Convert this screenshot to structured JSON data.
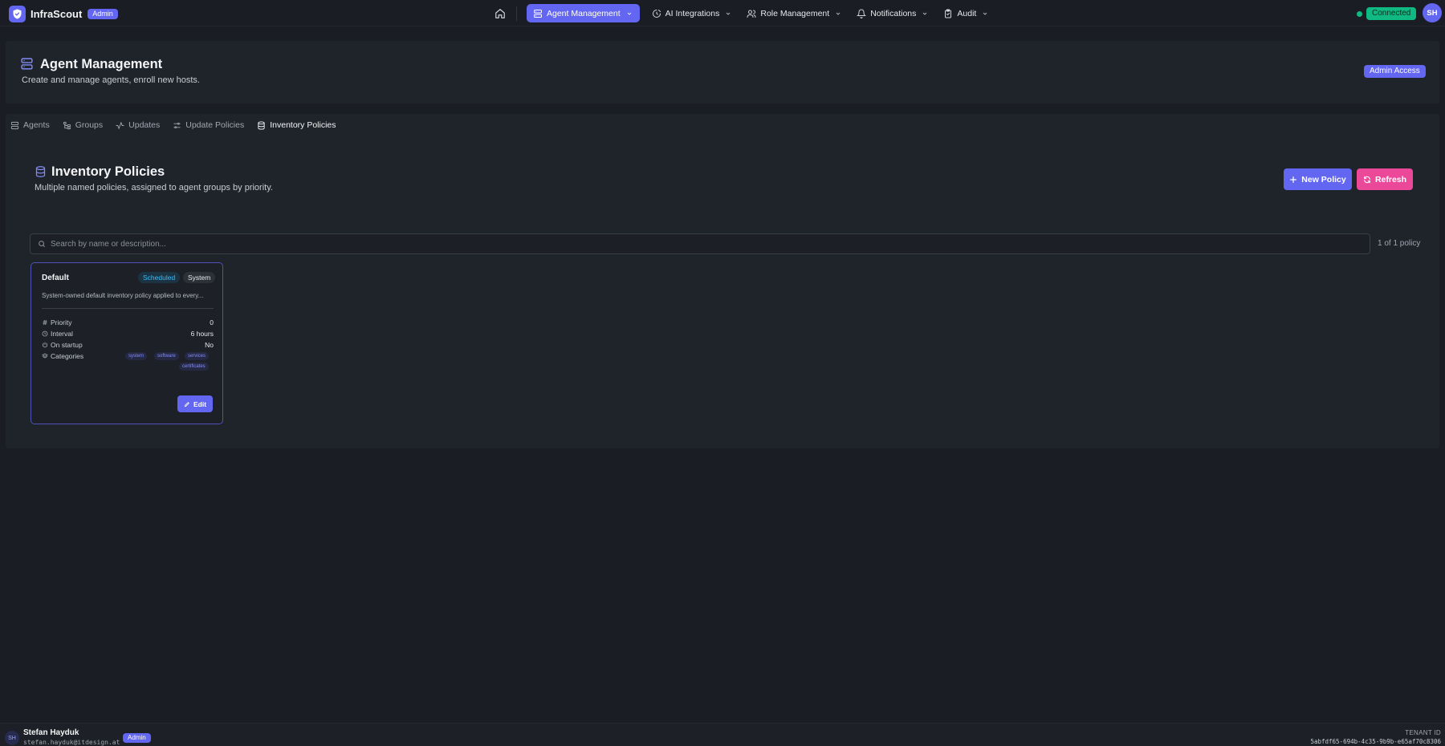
{
  "app": {
    "name": "InfraScout",
    "role_badge": "Admin"
  },
  "nav": {
    "home_icon": "home-icon",
    "items": [
      {
        "label": "Agent Management",
        "icon": "server-icon",
        "active": true
      },
      {
        "label": "AI Integrations",
        "icon": "ai-icon",
        "active": false
      },
      {
        "label": "Role Management",
        "icon": "users-icon",
        "active": false
      },
      {
        "label": "Notifications",
        "icon": "bell-icon",
        "active": false
      },
      {
        "label": "Audit",
        "icon": "clipboard-icon",
        "active": false
      }
    ]
  },
  "status": {
    "label": "Connected",
    "color": "#10b981"
  },
  "user_avatar": "SH",
  "page": {
    "title": "Agent Management",
    "subtitle": "Create and manage agents, enroll new hosts.",
    "access_badge": "Admin Access"
  },
  "tabs": [
    {
      "label": "Agents",
      "icon": "server-icon",
      "active": false
    },
    {
      "label": "Groups",
      "icon": "tree-icon",
      "active": false
    },
    {
      "label": "Updates",
      "icon": "activity-icon",
      "active": false
    },
    {
      "label": "Update Policies",
      "icon": "sliders-icon",
      "active": false
    },
    {
      "label": "Inventory Policies",
      "icon": "database-icon",
      "active": true
    }
  ],
  "section": {
    "title": "Inventory Policies",
    "subtitle": "Multiple named policies, assigned to agent groups by priority.",
    "new_button": "New Policy",
    "refresh_button": "Refresh"
  },
  "search": {
    "placeholder": "Search by name or description...",
    "value": "",
    "count": "1 of 1 policy"
  },
  "policies": [
    {
      "name": "Default",
      "badges": [
        "Scheduled",
        "System"
      ],
      "description": "System-owned default inventory policy applied to every...",
      "properties": [
        {
          "key": "Priority",
          "value": "0",
          "icon": "hash-icon"
        },
        {
          "key": "Interval",
          "value": "6 hours",
          "icon": "clock-icon"
        },
        {
          "key": "On startup",
          "value": "No",
          "icon": "power-icon"
        },
        {
          "key": "Categories",
          "value": "",
          "icon": "layers-icon"
        }
      ],
      "categories": [
        "system",
        "software",
        "services",
        "certificates"
      ],
      "edit_label": "Edit"
    }
  ],
  "footer": {
    "avatar": "SH",
    "name": "Stefan Hayduk",
    "email": "stefan.hayduk@itdesign.at",
    "role": "Admin",
    "tenant_label": "TENANT ID",
    "tenant_id": "5abfdf65-694b-4c35-9b9b-e65af70c8306"
  },
  "colors": {
    "accent": "#6366f1",
    "refresh": "#ec4899",
    "scheduled": "#38bdf8",
    "background": "#1a1d23"
  }
}
